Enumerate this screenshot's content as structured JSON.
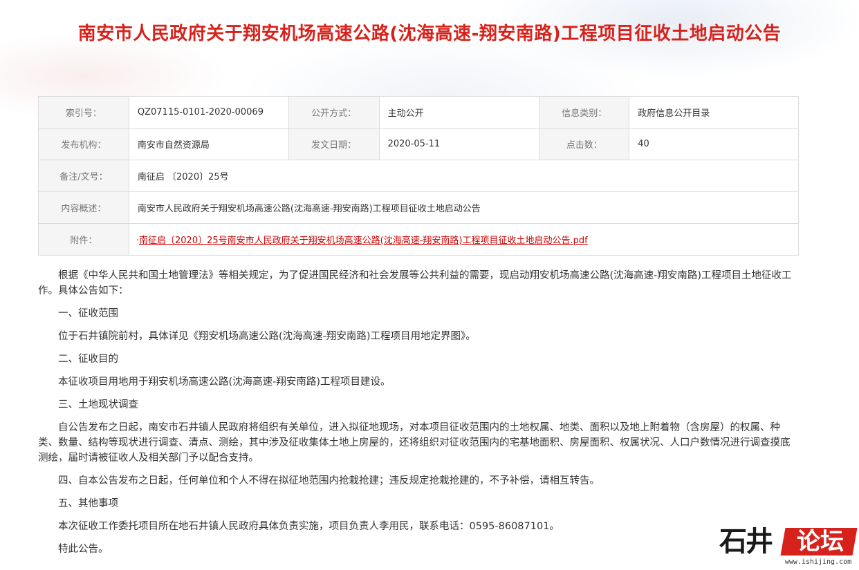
{
  "title": "南安市人民政府关于翔安机场高速公路(沈海高速-翔安南路)工程项目征收土地启动公告",
  "meta": {
    "index_label": "索引号：",
    "index_value": "QZ07115-0101-2020-00069",
    "open_mode_label": "公开方式：",
    "open_mode_value": "主动公开",
    "category_label": "信息类别：",
    "category_value": "政府信息公开目录",
    "publisher_label": "发布机构：",
    "publisher_value": "南安市自然资源局",
    "date_label": "发文日期：",
    "date_value": "2020-05-11",
    "hits_label": "点击数：",
    "hits_value": "40",
    "doc_no_label": "备注/文号：",
    "doc_no_value": "南征启 〔2020〕25号",
    "summary_label": "内容概述：",
    "summary_value": "南安市人民政府关于翔安机场高速公路(沈海高速-翔安南路)工程项目征收土地启动公告",
    "attachment_label": "附件：",
    "attachment_dot": "·",
    "attachment_value": "南征启〔2020〕25号南安市人民政府关于翔安机场高速公路(沈海高速-翔安南路)工程项目征收土地启动公告.pdf"
  },
  "body": [
    "根据《中华人民共和国土地管理法》等相关规定，为了促进国民经济和社会发展等公共利益的需要，现启动翔安机场高速公路(沈海高速-翔安南路)工程项目土地征收工作。具体公告如下：",
    "一、征收范围",
    "位于石井镇院前村，具体详见《翔安机场高速公路(沈海高速-翔安南路)工程项目用地定界图》。",
    "二、征收目的",
    "本征收项目用地用于翔安机场高速公路(沈海高速-翔安南路)工程项目建设。",
    "三、土地现状调查",
    "自公告发布之日起，南安市石井镇人民政府将组织有关单位，进入拟征地现场，对本项目征收范围内的土地权属、地类、面积以及地上附着物（含房屋）的权属、种类、数量、结构等现状进行调查、清点、测绘，其中涉及征收集体土地上房屋的，还将组织对征收范围内的宅基地面积、房屋面积、权属状况、人口户数情况进行调查摸底测绘，届时请被征收人及相关部门予以配合支持。",
    "四、自本公告发布之日起，任何单位和个人不得在拟征地范围内抢栽抢建；违反规定抢栽抢建的，不予补偿，请相互转告。",
    "五、其他事项",
    "本次征收工作委托项目所在地石井镇人民政府具体负责实施，项目负责人李用民，联系电话：0595-86087101。",
    "特此公告。"
  ],
  "logo": {
    "part1": "石井",
    "part2": "论坛",
    "url": "www.ishijing.com"
  },
  "colors": {
    "title": "#d7221b",
    "attachment_link": "#cc0000",
    "label_bg": "#f5f5f5",
    "border": "#dcdcdc"
  }
}
